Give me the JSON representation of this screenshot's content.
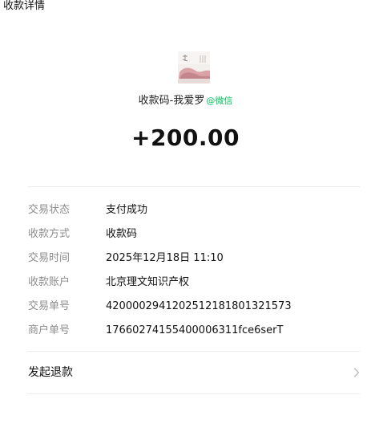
{
  "page": {
    "title": "收款详情"
  },
  "payee": {
    "name": "收款码-我爱罗",
    "at": "@",
    "source": "微信"
  },
  "amount": "+200.00",
  "details": [
    {
      "key": "交易状态",
      "value": "支付成功"
    },
    {
      "key": "收款方式",
      "value": "收款码"
    },
    {
      "key": "交易时间",
      "value": "2025年12月18日 11:10"
    },
    {
      "key": "收款账户",
      "value": "北京理文知识产权"
    },
    {
      "key": "交易单号",
      "value": "4200002941202512181801321573"
    },
    {
      "key": "商户单号",
      "value": "1766027415540000​6311fce6serT"
    }
  ],
  "actions": {
    "refund_label": "发起退款"
  },
  "icons": {
    "avatar": "avatar-image",
    "chevron": "chevron-right-icon"
  },
  "colors": {
    "accent": "#07c160",
    "label": "#8d8d8d",
    "text": "#111111",
    "divider": "#ececec"
  }
}
